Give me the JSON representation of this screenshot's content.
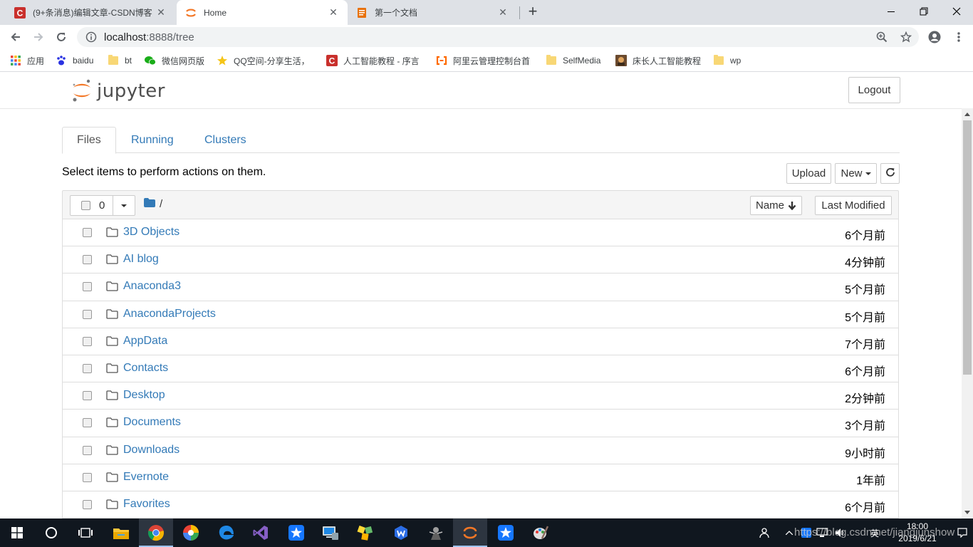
{
  "browser": {
    "tabs": [
      {
        "title": "(9+条消息)编辑文章-CSDN博客",
        "favicon": "csdn-icon",
        "active": false
      },
      {
        "title": "Home",
        "favicon": "jupyter-icon",
        "active": true
      },
      {
        "title": "第一个文档",
        "favicon": "document-icon",
        "active": false
      }
    ],
    "new_tab": "+",
    "url_host": "localhost",
    "url_rest": ":8888/tree",
    "bookmarks": [
      {
        "label": "应用",
        "icon": "apps-grid-icon"
      },
      {
        "label": "baidu",
        "icon": "baidu-paw-icon"
      },
      {
        "label": "bt",
        "icon": "folder-icon"
      },
      {
        "label": "微信网页版",
        "icon": "wechat-icon"
      },
      {
        "label": "QQ空间-分享生活，",
        "icon": "qzone-star-icon"
      },
      {
        "label": "人工智能教程 - 序言",
        "icon": "csdn-icon"
      },
      {
        "label": "阿里云管理控制台首",
        "icon": "aliyun-icon"
      },
      {
        "label": "SelfMedia",
        "icon": "folder-icon"
      },
      {
        "label": "床长人工智能教程",
        "icon": "image-icon"
      },
      {
        "label": "wp",
        "icon": "folder-icon"
      }
    ]
  },
  "jupyter": {
    "logo_text": "jupyter",
    "logout_label": "Logout",
    "tabs": [
      "Files",
      "Running",
      "Clusters"
    ],
    "hint": "Select items to perform actions on them.",
    "upload_label": "Upload",
    "new_label": "New",
    "selected_count": "0",
    "breadcrumb": "/",
    "sort_name_label": "Name",
    "sort_modified_label": "Last Modified",
    "files": [
      {
        "name": "3D Objects",
        "modified": "6个月前"
      },
      {
        "name": "AI blog",
        "modified": "4分钟前"
      },
      {
        "name": "Anaconda3",
        "modified": "5个月前"
      },
      {
        "name": "AnacondaProjects",
        "modified": "5个月前"
      },
      {
        "name": "AppData",
        "modified": "7个月前"
      },
      {
        "name": "Contacts",
        "modified": "6个月前"
      },
      {
        "name": "Desktop",
        "modified": "2分钟前"
      },
      {
        "name": "Documents",
        "modified": "3个月前"
      },
      {
        "name": "Downloads",
        "modified": "9小时前"
      },
      {
        "name": "Evernote",
        "modified": "1年前"
      },
      {
        "name": "Favorites",
        "modified": "6个月前"
      }
    ]
  },
  "taskbar": {
    "apps": [
      "windows-start-icon",
      "search-circle-icon",
      "task-view-icon",
      "file-explorer-icon",
      "chrome-icon",
      "pinwheel-icon",
      "edge-icon",
      "visual-studio-icon",
      "star-app-icon",
      "remote-desktop-icon",
      "puzzle-app-icon",
      "wps-icon",
      "game-icon",
      "jupyter-icon",
      "star-app-2-icon",
      "paint-icon"
    ],
    "time": "18:00",
    "date": "2019/6/21",
    "tray_lang": "英",
    "watermark": "https://blog.csdn.net/jiangjunshow"
  }
}
